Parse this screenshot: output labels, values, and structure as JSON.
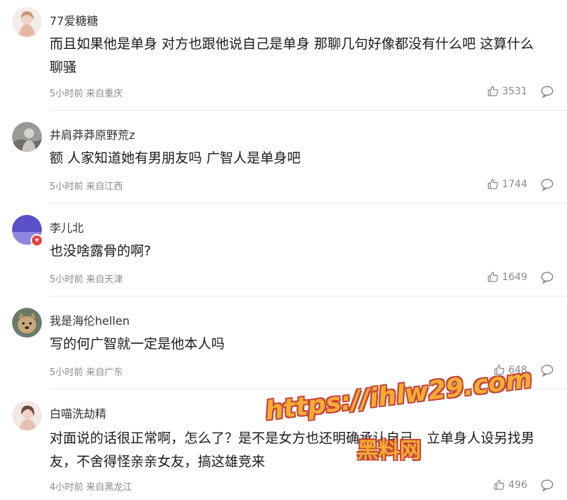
{
  "comments": [
    {
      "username": "77爱糖糖",
      "text": "而且如果他是单身 对方也跟他说自己是单身 那聊几句好像都没有什么吧 这算什么聊骚",
      "time": "5小时前",
      "location": "来自重庆",
      "likes": "3531"
    },
    {
      "username": "井肩莽莽原野荒z",
      "text": "额 人家知道她有男朋友吗 广智人是单身吧",
      "time": "5小时前",
      "location": "来自江西",
      "likes": "1744"
    },
    {
      "username": "李儿北",
      "text": "也没啥露骨的啊?",
      "time": "5小时前",
      "location": "来自天津",
      "likes": "1649"
    },
    {
      "username": "我是海伦hellen",
      "text": "写的何广智就一定是他本人吗",
      "time": "5小时前",
      "location": "来自广东",
      "likes": "648"
    },
    {
      "username": "白喵洗劫精",
      "text": "对面说的话很正常啊，怎么了？是不是女方也还明确承认自己，立单身人设另找男友，不舍得怪亲亲女友，搞这雄竞来",
      "time": "4小时前",
      "location": "来自黑龙江",
      "likes": "496"
    }
  ],
  "watermark": {
    "url": "https://ihlw29.com",
    "name": "黑料网"
  },
  "colors": {
    "text": "#1a1a1a",
    "meta": "#8a8a8a",
    "divider": "#e8e8e8",
    "vip_badge": "#e8403a",
    "watermark": "#f6a623"
  }
}
